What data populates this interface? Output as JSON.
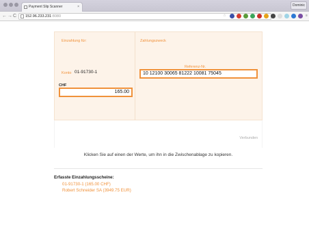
{
  "browser": {
    "tab_title": "Payment Slip Scanner",
    "tab_close": "×",
    "profile_label": "Dominic",
    "back": "←",
    "forward": "→",
    "reload": "C",
    "url_host": "152.96.233.231",
    "url_port": ":8080"
  },
  "slip": {
    "einzahlung_label": "Einzahlung für:",
    "zahlungszweck_label": "Zahlungszweck",
    "konto_label": "Konto",
    "konto_value": "01-91730-1",
    "chf_label": "CHF",
    "amount_value": "165.00",
    "referenz_label": "Referenz-Nr.",
    "referenz_value": "10 12100 30065 81222 10081 75045"
  },
  "actions": {
    "send_label": "Verbunden"
  },
  "hint_text": "Klicken Sie auf einen der Werte, um ihn in die Zwischenablage zu kopieren.",
  "captured": {
    "title": "Erfasste Einzahlungsscheine:",
    "items": [
      "01-91730-1 (165.00 CHF)",
      "Robert Schneider SA (3949.75 EUR)"
    ]
  },
  "colors": {
    "accent": "#f0913a",
    "panel": "#fdf3e9"
  }
}
